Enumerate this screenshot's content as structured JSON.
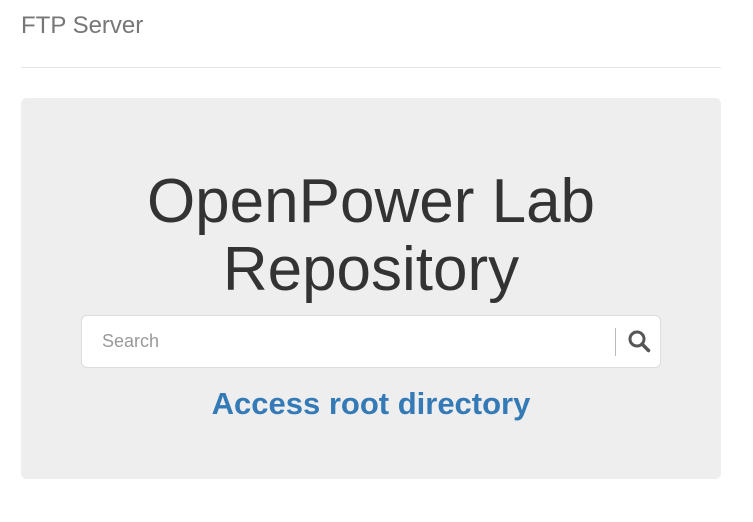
{
  "header": {
    "brand": "FTP Server"
  },
  "jumbotron": {
    "title": "OpenPower Lab Repository",
    "search": {
      "placeholder": "Search",
      "value": "",
      "icon": "search-icon"
    },
    "root_link": "Access root directory"
  },
  "colors": {
    "brand_text": "#777777",
    "jumbotron_bg": "#eeeeee",
    "title_text": "#333333",
    "link": "#337ab7"
  }
}
